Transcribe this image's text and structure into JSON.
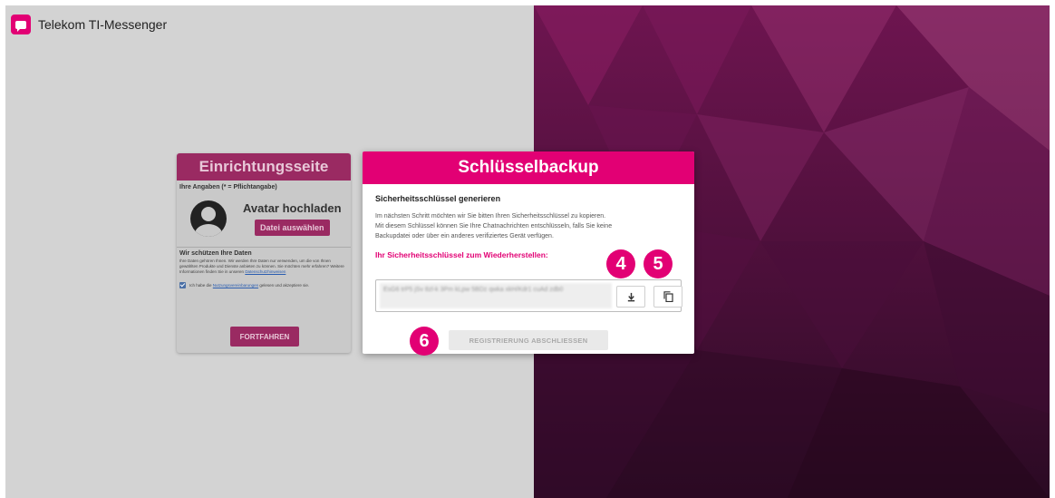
{
  "app": {
    "title": "Telekom TI-Messenger"
  },
  "setup": {
    "title": "Einrichtungsseite",
    "subtitle": "Ihre Angaben (* = Pflichtangabe)",
    "avatar_title": "Avatar hochladen",
    "file_button": "Datei auswählen",
    "privacy_title": "Wir schützen Ihre Daten",
    "privacy_text": "Ihre Daten gehören Ihnen. Wir werden Ihre Daten nur verwenden, um die von Ihnen gewählten Produkte und Dienste anbieten zu können. Sie möchten mehr erfahren? Weitere Informationen finden Sie in unseren",
    "privacy_link": "Datenschutzhinweisen",
    "consent_prefix": "Ich habe die",
    "consent_link": "Nutzungsvereinbarungen",
    "consent_suffix": "gelesen und akzeptiere sie.",
    "consent_checked": true,
    "continue_button": "FORTFAHREN"
  },
  "modal": {
    "title": "Schlüsselbackup",
    "subtitle": "Sicherheitsschlüssel generieren",
    "line1": "Im nächsten Schritt möchten wir Sie bitten Ihren Sicherheitsschlüssel zu kopieren.",
    "line2": "Mit diesem Schlüssel können Sie Ihre Chatnachrichten entschlüsseln, falls Sie keine",
    "line3": "Backupdatei oder über ein anderes verifiziertes Gerät verfügen.",
    "key_label": "Ihr Sicherheitsschlüssel zum Wiederherstellen:",
    "key_value": "EsG6 trP5 jSv 8zl-k 3Pm kLpw 5BDz qwka xkH/Kdr1 cuAd zdb0",
    "finish_button": "REGISTRIERUNG ABSCHLIESSEN"
  },
  "badges": {
    "step4": "4",
    "step5": "5",
    "step6": "6"
  },
  "colors": {
    "accent": "#e20074",
    "dimmed_accent": "#9a2a62",
    "left_bg": "#d3d3d3"
  },
  "icons": {
    "download": "download-icon",
    "copy": "copy-icon",
    "logo": "messenger-logo-icon"
  }
}
